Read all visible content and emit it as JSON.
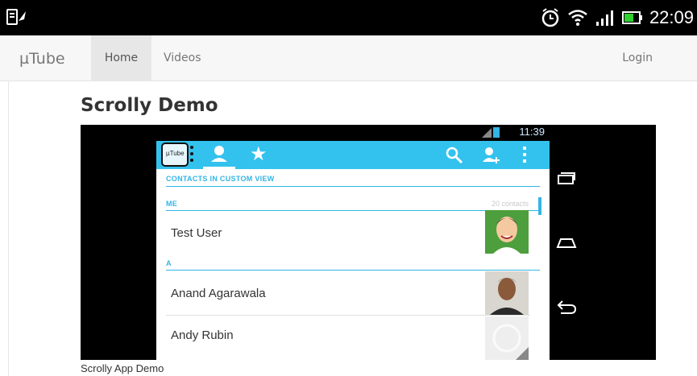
{
  "status_bar": {
    "time": "22:09",
    "icons": [
      "sim-icon",
      "alarm-icon",
      "wifi-icon",
      "signal-icon",
      "battery-icon"
    ]
  },
  "navbar": {
    "brand": "µTube",
    "items": [
      {
        "label": "Home",
        "active": true
      },
      {
        "label": "Videos",
        "active": false
      }
    ],
    "login_label": "Login"
  },
  "page": {
    "title": "Scrolly Demo",
    "video_caption": "Scrolly App Demo"
  },
  "video_frame": {
    "status_time": "11:39",
    "app": {
      "logo_text": "µTube",
      "header": "CONTACTS IN CUSTOM VIEW",
      "section_me": "ME",
      "contact_count": "20 contacts",
      "section_a": "A",
      "contacts": [
        "Test User",
        "Anand Agarawala",
        "Andy Rubin"
      ]
    },
    "accent_color": "#33b5e5"
  }
}
